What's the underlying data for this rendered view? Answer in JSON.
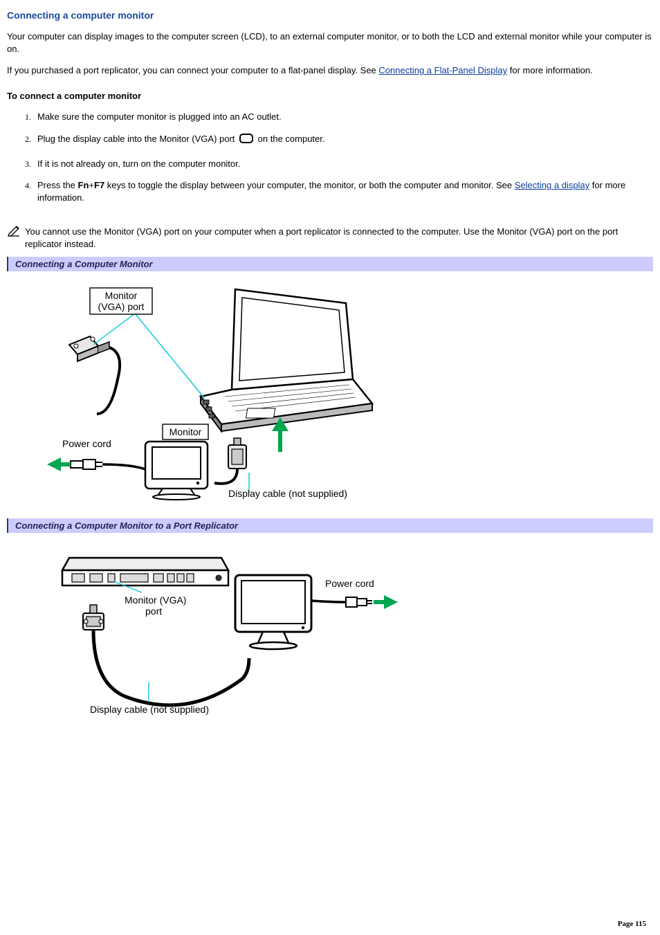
{
  "title": "Connecting a computer monitor",
  "para1": {
    "text": "Your computer can display images to the computer screen (LCD), to an external computer monitor, or to both the LCD and external monitor while your computer is on."
  },
  "para2": {
    "pre": "If you purchased a port replicator, you can connect your computer to a flat-panel display. See ",
    "link": "Connecting a Flat-Panel Display",
    "post": " for more information."
  },
  "subhead": "To connect a computer monitor",
  "steps": {
    "s1": "Make sure the computer monitor is plugged into an AC outlet.",
    "s2": {
      "pre": "Plug the display cable into the Monitor (VGA) port ",
      "post": " on the computer."
    },
    "s3": "If it is not already on, turn on the computer monitor.",
    "s4": {
      "pre": "Press the ",
      "fn": "Fn",
      "plus": "+",
      "f7": "F7",
      "mid": " keys to toggle the display between your computer, the monitor, or both the computer and monitor. See ",
      "link": "Selecting a display",
      "post": " for more information."
    }
  },
  "note": "You cannot use the Monitor (VGA) port on your computer when a port replicator is connected to the computer. Use the Monitor (VGA) port on the port replicator instead.",
  "caption1": "Connecting a Computer Monitor",
  "fig1_labels": {
    "vga": "Monitor\n(VGA) port",
    "powercord": "Power cord",
    "monitor": "Monitor",
    "cable": "Display cable (not supplied)"
  },
  "caption2": "Connecting a Computer Monitor to a Port Replicator",
  "fig2_labels": {
    "vga": "Monitor (VGA)\nport",
    "powercord": "Power cord",
    "cable": "Display cable (not supplied)"
  },
  "page": "Page 115"
}
